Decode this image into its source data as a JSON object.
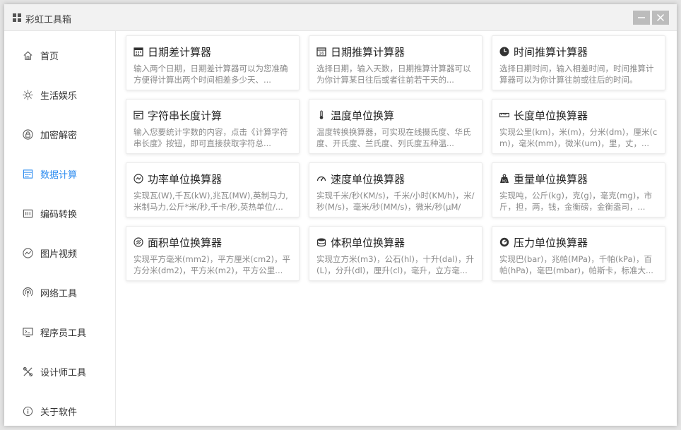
{
  "window": {
    "title": "彩虹工具箱",
    "minimize_icon": "minimize-icon",
    "close_icon": "close-icon"
  },
  "sidebar": {
    "items": [
      {
        "label": "首页",
        "icon": "home-icon",
        "active": false
      },
      {
        "label": "生活娱乐",
        "icon": "sun-icon",
        "active": false
      },
      {
        "label": "加密解密",
        "icon": "lock-icon",
        "active": false
      },
      {
        "label": "数据计算",
        "icon": "calculator-icon",
        "active": true
      },
      {
        "label": "编码转换",
        "icon": "code-icon",
        "active": false
      },
      {
        "label": "图片视频",
        "icon": "image-icon",
        "active": false
      },
      {
        "label": "网络工具",
        "icon": "network-icon",
        "active": false
      },
      {
        "label": "程序员工具",
        "icon": "terminal-icon",
        "active": false
      },
      {
        "label": "设计师工具",
        "icon": "design-icon",
        "active": false
      },
      {
        "label": "关于软件",
        "icon": "info-icon",
        "active": false
      }
    ],
    "accent_color": "#2d8cf0"
  },
  "tools": [
    {
      "title": "日期差计算器",
      "icon": "calendar-icon",
      "desc": "输入两个日期，日期差计算器可以为您准确方便得计算出两个时间相差多少天、..."
    },
    {
      "title": "日期推算计算器",
      "icon": "calendar-forward-icon",
      "desc": "选择日期，输入天数，日期推算计算器可以为你计算某日往后或者往前若干天的..."
    },
    {
      "title": "时间推算计算器",
      "icon": "clock-icon",
      "desc": "选择日期时间，输入相差时间，时间推算计算器可以为你计算往前或往后的时间。"
    },
    {
      "title": "字符串长度计算",
      "icon": "text-length-icon",
      "desc": "输入您要统计字数的内容，点击《计算字符串长度》按钮，即可直接获取字符总..."
    },
    {
      "title": "温度单位换算",
      "icon": "thermometer-icon",
      "desc": "温度转换换算器，可实现在线摄氏度、华氏度、开氏度、兰氏度、列氏度五种温..."
    },
    {
      "title": "长度单位换算器",
      "icon": "ruler-icon",
      "desc": "实现公里(km)，米(m)，分米(dm)，厘米(cm)，毫米(mm)，微米(um)，里，丈，..."
    },
    {
      "title": "功率单位换算器",
      "icon": "power-icon",
      "desc": "实现瓦(W),千瓦(kW),兆瓦(MW),英制马力,米制马力,公斤*米/秒,千卡/秒,英热单位/..."
    },
    {
      "title": "速度单位换算器",
      "icon": "speedometer-icon",
      "desc": "实现千米/秒(KM/s)，千米/小时(KM/h)，米/秒(M/s)，毫米/秒(MM/s)，微米/秒(μM/s)..."
    },
    {
      "title": "重量单位换算器",
      "icon": "weight-icon",
      "desc": "实现吨，公斤(kg)，克(g)，毫克(mg)，市斤，担，两，钱，金衡磅，金衡盎司，..."
    },
    {
      "title": "面积单位换算器",
      "icon": "area-icon",
      "desc": "实现平方毫米(mm2)，平方厘米(cm2)，平方分米(dm2)，平方米(m2)，平方公里..."
    },
    {
      "title": "体积单位换算器",
      "icon": "volume-icon",
      "desc": "实现立方米(m3)，公石(hl)，十升(dal)，升(L)，分升(dl)，厘升(cl)，毫升，立方毫..."
    },
    {
      "title": "压力单位换算器",
      "icon": "pressure-icon",
      "desc": "实现巴(bar)，兆帕(MPa)，千帕(kPa)，百帕(hPa)，毫巴(mbar)，帕斯卡，标准大..."
    }
  ]
}
